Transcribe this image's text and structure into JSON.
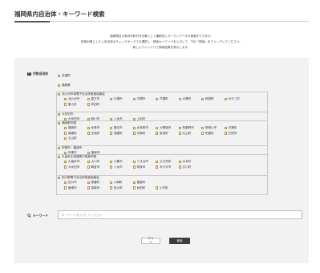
{
  "header": {
    "title": "福岡県内自治体・キーワード検索"
  },
  "intro": {
    "lines": [
      "福岡県及び県内市町村を対象として横断的にオープンデータの検索ができます。",
      "検索対象にしたい自治体のチェックボックスを選択し、検索キーワードを入力して、下の「検索」をクリックしてください。",
      "新しいウィンドウで検索結果を表示します。"
    ]
  },
  "municipality": {
    "label": "対象自治体",
    "select_all": "全選択",
    "prefecture": "福岡県",
    "groups": [
      {
        "name": "北九州市域電子自治体推進協議会",
        "rows": [
          [
            "北九州市",
            "直方市",
            "行橋市",
            "中間市",
            "芦屋町",
            "水巻町",
            "岡垣町",
            "みやこ町"
          ],
          [
            "築上町",
            "苅田町"
          ]
        ]
      },
      {
        "name": "大牟田市",
        "rows": [
          [
            "大牟田市",
            "柳川市",
            "八女市",
            "上毛町"
          ]
        ]
      },
      {
        "name": "福岡都市圏",
        "rows": [
          [
            "福岡市",
            "糸島市",
            "春日市",
            "太宰府市",
            "大野城市",
            "筑紫野市",
            "那珂川市",
            "宇美町"
          ],
          [
            "篠栗町",
            "志免町",
            "須恵町",
            "宇美町",
            "新宮町",
            "久山町",
            "粕屋町",
            "古賀市"
          ],
          [
            "久山町"
          ]
        ]
      },
      {
        "name": "宗像市・福津市",
        "rows": [
          [
            "宗像市",
            "福津市"
          ]
        ]
      },
      {
        "name": "久留米広域連携中枢都市圏",
        "rows": [
          [
            "久留米市",
            "大川市",
            "小郡市",
            "うきは市",
            "大刀洗町",
            "大木町"
          ],
          [
            "大牟田市",
            "朝倉市",
            "八女市",
            "筑後市",
            "みやま市",
            "広川町"
          ]
        ]
      },
      {
        "name": "田川郡電子自治体推進協議会",
        "rows": [
          [
            "田川市",
            "香春町",
            "川崎町",
            "福智町"
          ],
          [
            "飯塚市",
            "嘉麻市",
            "桂川町",
            "糸田町",
            "小竹町"
          ]
        ]
      }
    ]
  },
  "keyword": {
    "label": "キーワード",
    "placeholder": "キーワードを入力してください"
  },
  "buttons": {
    "clear": "クリア",
    "search": "検索"
  }
}
